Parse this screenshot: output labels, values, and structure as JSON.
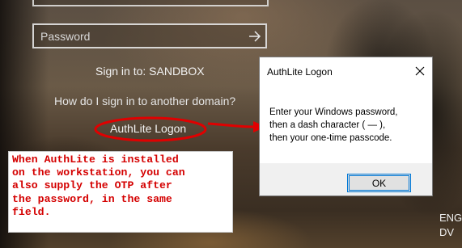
{
  "login": {
    "password_placeholder": "Password",
    "sign_in_to": "Sign in to: SANDBOX",
    "other_domain": "How do I sign in to another domain?",
    "authlite_link": "AuthLite Logon"
  },
  "callout": {
    "lines": [
      "When AuthLite is installed",
      "on the workstation, you can",
      "also supply the OTP after",
      "the password, in the same",
      "field."
    ],
    "color": "#d40000"
  },
  "dialog": {
    "title": "AuthLite Logon",
    "message_lines": [
      "Enter your Windows password,",
      "then a dash character ( — ),",
      "then your one-time passcode."
    ],
    "ok_label": "OK"
  },
  "taskbar": {
    "lang_line1": "ENG",
    "lang_line2": "DV"
  },
  "icons": {
    "submit": "arrow-right-icon",
    "close": "close-icon"
  }
}
